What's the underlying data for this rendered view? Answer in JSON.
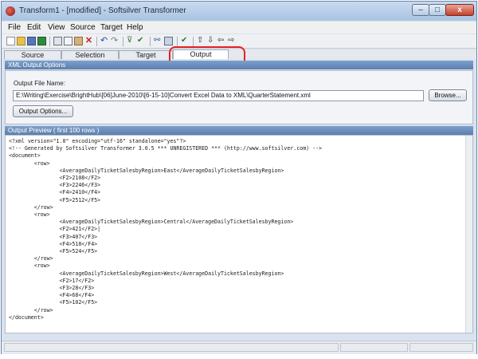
{
  "window": {
    "title": "Transform1 - [modified] - Softsilver Transformer",
    "minimize_glyph": "–",
    "maximize_glyph": "□",
    "close_glyph": "x"
  },
  "menu": [
    "File",
    "Edit",
    "View",
    "Source",
    "Target",
    "Help"
  ],
  "toolbar_icons": [
    "new-icon",
    "open-icon",
    "save-icon",
    "run-icon",
    "cut-icon",
    "copy-icon",
    "paste-icon",
    "delete-icon",
    "undo-icon",
    "redo-icon",
    "filter-icon",
    "filter-check-icon",
    "link-icon",
    "node-icon",
    "check-icon",
    "move-up-icon",
    "move-down-icon",
    "move-left-icon",
    "move-right-icon"
  ],
  "tabs": [
    {
      "label": "Source",
      "active": false
    },
    {
      "label": "Selection",
      "active": false
    },
    {
      "label": "Target",
      "active": false
    },
    {
      "label": "Output",
      "active": true
    }
  ],
  "xml_options": {
    "header": "XML Output Options",
    "file_name_label": "Output File Name:",
    "file_path": "E:\\Writing\\Exercise\\BrightHub\\[06]June-2010\\[6-15-10]Convert Excel Data to XML\\QuarterStatement.xml",
    "browse_label": "Browse...",
    "options_label": "Output Options..."
  },
  "preview": {
    "header": "Output Preview ( first 100 rows )",
    "lines": [
      "<?xml version=\"1.0\" encoding=\"utf-16\" standalone=\"yes\"?>",
      "<!-- Generated by Softsilver Transformer 3.0.5 *** UNREGISTERED *** (http://www.softsilver.com) -->",
      "<document>",
      "        <row>",
      "                <AverageDailyTicketSalesbyRegion>East</AverageDailyTicketSalesbyRegion>",
      "                <F2>2108</F2>",
      "                <F3>2246</F3>",
      "                <F4>2410</F4>",
      "                <F5>2512</F5>",
      "        </row>",
      "        <row>",
      "                <AverageDailyTicketSalesbyRegion>Central</AverageDailyTicketSalesbyRegion>",
      "                <F2>421</F2>|",
      "                <F3>407</F3>",
      "                <F4>518</F4>",
      "                <F5>524</F5>",
      "        </row>",
      "        <row>",
      "                <AverageDailyTicketSalesbyRegion>West</AverageDailyTicketSalesbyRegion>",
      "                <F2>17</F2>",
      "                <F3>28</F3>",
      "                <F4>68</F4>",
      "                <F5>102</F5>",
      "        </row>",
      "</document>"
    ]
  },
  "colors": {
    "highlight": "#e52222",
    "section_header": "#5b7fae"
  }
}
